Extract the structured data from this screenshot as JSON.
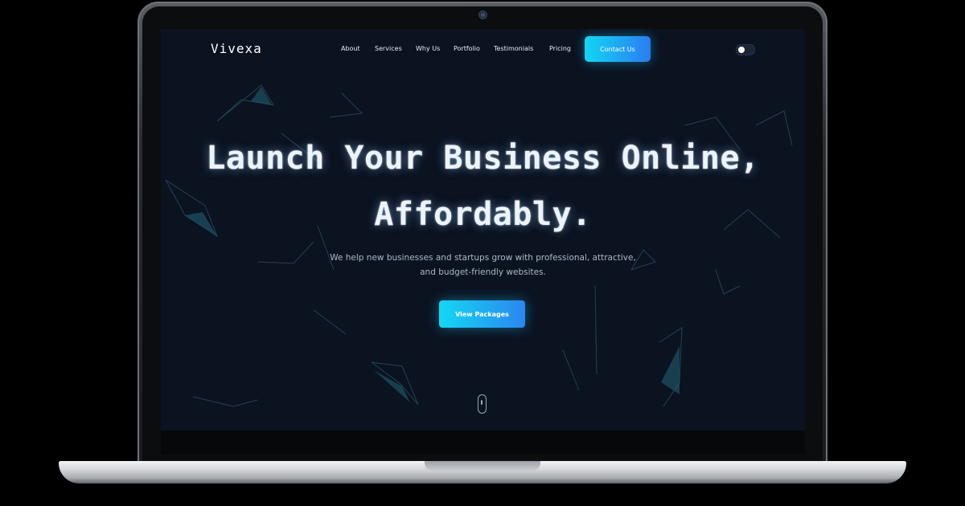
{
  "site": {
    "logo": "Vivexa"
  },
  "nav": {
    "links": [
      "About",
      "Services",
      "Why Us",
      "Portfolio",
      "Testimonials",
      "Pricing"
    ],
    "contact_label": "Contact Us"
  },
  "theme_toggle": {
    "state": "off"
  },
  "hero": {
    "title_line1": "Launch Your Business Online,",
    "title_line2": "Affordably.",
    "subtitle": "We help new businesses and startups grow with professional, attractive, and budget-friendly websites.",
    "cta_label": "View Packages"
  },
  "colors": {
    "page_bg": "#0b1220",
    "accent_start": "#12d7f5",
    "accent_end": "#2a7cf0",
    "text": "#eef3fb"
  },
  "icons": {
    "scroll": "mouse-scroll-icon"
  }
}
